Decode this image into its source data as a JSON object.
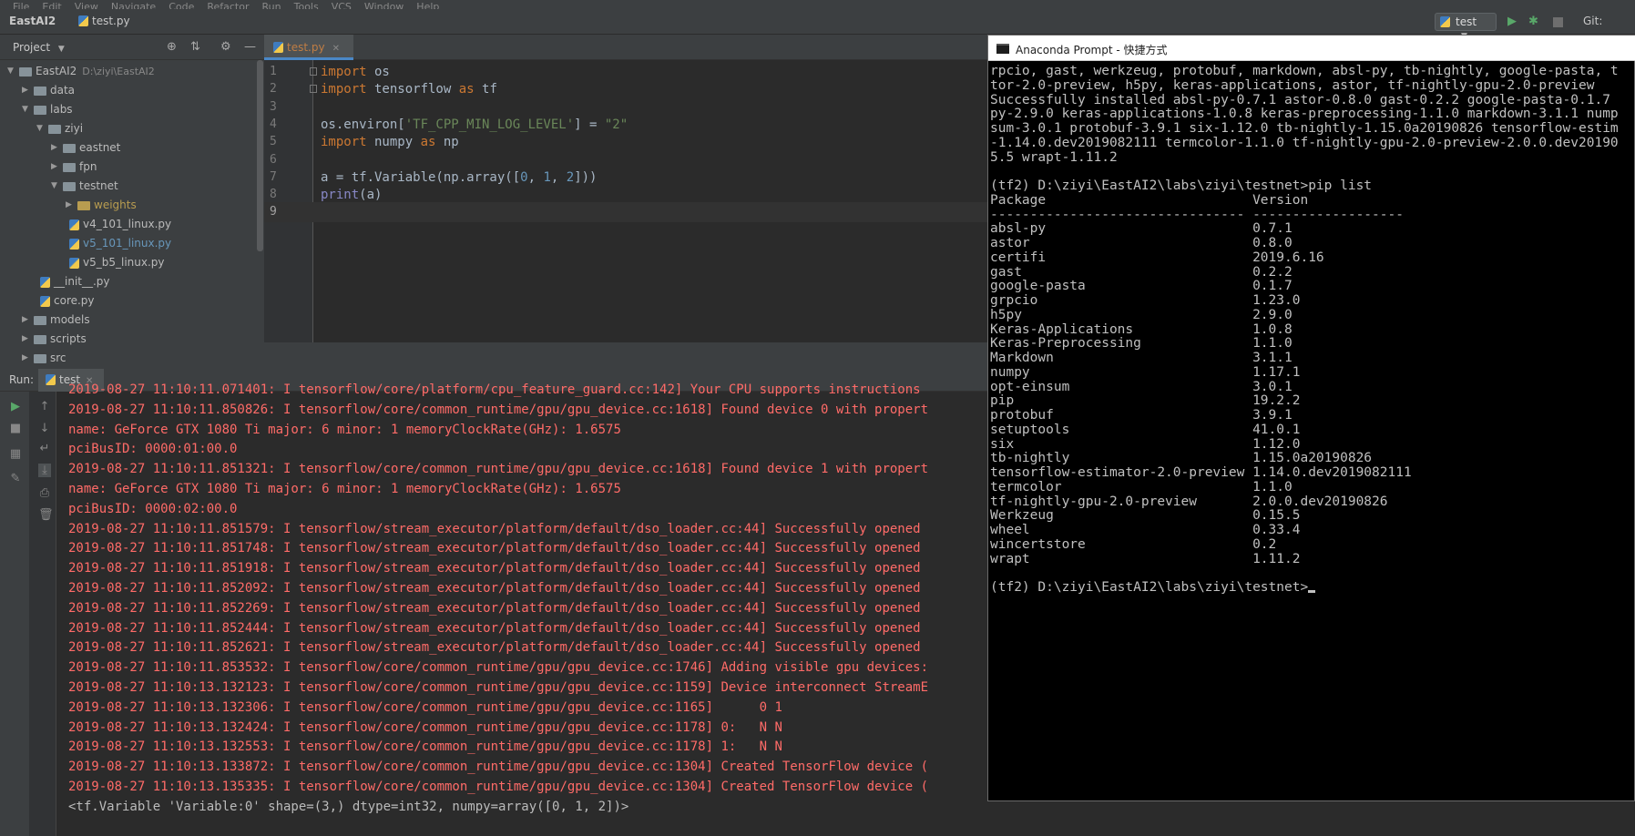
{
  "menubar": [
    "File",
    "Edit",
    "View",
    "Navigate",
    "Code",
    "Refactor",
    "Run",
    "Tools",
    "VCS",
    "Window",
    "Help"
  ],
  "navbar": {
    "project": "EastAI2",
    "file": "test.py",
    "run_config": "test",
    "git_label": "Git:"
  },
  "project_panel": {
    "title": "Project",
    "tree": [
      {
        "label": "EastAI2",
        "hint": "D:\\ziyi\\EastAI2",
        "depth": 0,
        "kind": "folder",
        "open": true
      },
      {
        "label": "data",
        "depth": 1,
        "kind": "folder",
        "open": false
      },
      {
        "label": "labs",
        "depth": 1,
        "kind": "folder",
        "open": true
      },
      {
        "label": "ziyi",
        "depth": 2,
        "kind": "folder",
        "open": true
      },
      {
        "label": "eastnet",
        "depth": 3,
        "kind": "folder",
        "open": false
      },
      {
        "label": "fpn",
        "depth": 3,
        "kind": "folder",
        "open": false
      },
      {
        "label": "testnet",
        "depth": 3,
        "kind": "folder",
        "open": true
      },
      {
        "label": "weights",
        "depth": 4,
        "kind": "folder-gold",
        "open": false
      },
      {
        "label": "v4_101_linux.py",
        "depth": 4,
        "kind": "file"
      },
      {
        "label": "v5_101_linux.py",
        "depth": 4,
        "kind": "file",
        "selected": true
      },
      {
        "label": "v5_b5_linux.py",
        "depth": 4,
        "kind": "file"
      },
      {
        "label": "__init__.py",
        "depth": 2,
        "kind": "file"
      },
      {
        "label": "core.py",
        "depth": 2,
        "kind": "file"
      },
      {
        "label": "models",
        "depth": 1,
        "kind": "folder",
        "open": false
      },
      {
        "label": "scripts",
        "depth": 1,
        "kind": "folder",
        "open": false
      },
      {
        "label": "src",
        "depth": 1,
        "kind": "folder",
        "open": false
      }
    ]
  },
  "editor": {
    "tab": "test.py",
    "lines": [
      {
        "n": "1",
        "tokens": [
          [
            "kw",
            "import"
          ],
          [
            "",
            " os"
          ]
        ]
      },
      {
        "n": "2",
        "tokens": [
          [
            "kw",
            "import"
          ],
          [
            "",
            " tensorflow "
          ],
          [
            "kw",
            "as"
          ],
          [
            "",
            " tf"
          ]
        ]
      },
      {
        "n": "3",
        "tokens": []
      },
      {
        "n": "4",
        "tokens": [
          [
            "",
            "os.environ["
          ],
          [
            "str",
            "'TF_CPP_MIN_LOG_LEVEL'"
          ],
          [
            "",
            "] = "
          ],
          [
            "str",
            "\"2\""
          ]
        ]
      },
      {
        "n": "5",
        "tokens": [
          [
            "kw",
            "import"
          ],
          [
            "",
            " numpy "
          ],
          [
            "kw",
            "as"
          ],
          [
            "",
            " np"
          ]
        ]
      },
      {
        "n": "6",
        "tokens": []
      },
      {
        "n": "7",
        "tokens": [
          [
            "",
            "a = tf.Variable(np.array(["
          ],
          [
            "num",
            "0"
          ],
          [
            "",
            ", "
          ],
          [
            "num",
            "1"
          ],
          [
            "",
            ", "
          ],
          [
            "num",
            "2"
          ],
          [
            "",
            "]))"
          ]
        ]
      },
      {
        "n": "8",
        "tokens": [
          [
            "fn",
            "print"
          ],
          [
            "",
            "(a)"
          ]
        ]
      },
      {
        "n": "9",
        "tokens": [],
        "current": true
      }
    ]
  },
  "run_panel": {
    "label": "Run:",
    "tab": "test",
    "console": [
      {
        "t": "2019-08-27 11:10:11.071401: I tensorflow/core/platform/cpu_feature_guard.cc:142] Your CPU supports instructions",
        "out": false
      },
      {
        "t": "2019-08-27 11:10:11.850826: I tensorflow/core/common_runtime/gpu/gpu_device.cc:1618] Found device 0 with propert",
        "out": false
      },
      {
        "t": "name: GeForce GTX 1080 Ti major: 6 minor: 1 memoryClockRate(GHz): 1.6575",
        "out": false
      },
      {
        "t": "pciBusID: 0000:01:00.0",
        "out": false
      },
      {
        "t": "2019-08-27 11:10:11.851321: I tensorflow/core/common_runtime/gpu/gpu_device.cc:1618] Found device 1 with propert",
        "out": false
      },
      {
        "t": "name: GeForce GTX 1080 Ti major: 6 minor: 1 memoryClockRate(GHz): 1.6575",
        "out": false
      },
      {
        "t": "pciBusID: 0000:02:00.0",
        "out": false
      },
      {
        "t": "2019-08-27 11:10:11.851579: I tensorflow/stream_executor/platform/default/dso_loader.cc:44] Successfully opened",
        "out": false
      },
      {
        "t": "2019-08-27 11:10:11.851748: I tensorflow/stream_executor/platform/default/dso_loader.cc:44] Successfully opened",
        "out": false
      },
      {
        "t": "2019-08-27 11:10:11.851918: I tensorflow/stream_executor/platform/default/dso_loader.cc:44] Successfully opened",
        "out": false
      },
      {
        "t": "2019-08-27 11:10:11.852092: I tensorflow/stream_executor/platform/default/dso_loader.cc:44] Successfully opened",
        "out": false
      },
      {
        "t": "2019-08-27 11:10:11.852269: I tensorflow/stream_executor/platform/default/dso_loader.cc:44] Successfully opened",
        "out": false
      },
      {
        "t": "2019-08-27 11:10:11.852444: I tensorflow/stream_executor/platform/default/dso_loader.cc:44] Successfully opened",
        "out": false
      },
      {
        "t": "2019-08-27 11:10:11.852621: I tensorflow/stream_executor/platform/default/dso_loader.cc:44] Successfully opened",
        "out": false
      },
      {
        "t": "2019-08-27 11:10:11.853532: I tensorflow/core/common_runtime/gpu/gpu_device.cc:1746] Adding visible gpu devices:",
        "out": false
      },
      {
        "t": "2019-08-27 11:10:13.132123: I tensorflow/core/common_runtime/gpu/gpu_device.cc:1159] Device interconnect StreamE",
        "out": false
      },
      {
        "t": "2019-08-27 11:10:13.132306: I tensorflow/core/common_runtime/gpu/gpu_device.cc:1165]      0 1",
        "out": false
      },
      {
        "t": "2019-08-27 11:10:13.132424: I tensorflow/core/common_runtime/gpu/gpu_device.cc:1178] 0:   N N",
        "out": false
      },
      {
        "t": "2019-08-27 11:10:13.132553: I tensorflow/core/common_runtime/gpu/gpu_device.cc:1178] 1:   N N",
        "out": false
      },
      {
        "t": "2019-08-27 11:10:13.133872: I tensorflow/core/common_runtime/gpu/gpu_device.cc:1304] Created TensorFlow device (",
        "out": false
      },
      {
        "t": "2019-08-27 11:10:13.135335: I tensorflow/core/common_runtime/gpu/gpu_device.cc:1304] Created TensorFlow device (",
        "out": false
      },
      {
        "t": "<tf.Variable 'Variable:0' shape=(3,) dtype=int32, numpy=array([0, 1, 2])>",
        "out": true
      }
    ]
  },
  "conda": {
    "title": "Anaconda Prompt - 快捷方式",
    "lines": [
      "rpcio, gast, werkzeug, protobuf, markdown, absl-py, tb-nightly, google-pasta, t",
      "tor-2.0-preview, h5py, keras-applications, astor, tf-nightly-gpu-2.0-preview",
      "Successfully installed absl-py-0.7.1 astor-0.8.0 gast-0.2.2 google-pasta-0.1.7",
      "py-2.9.0 keras-applications-1.0.8 keras-preprocessing-1.1.0 markdown-3.1.1 nump",
      "sum-3.0.1 protobuf-3.9.1 six-1.12.0 tb-nightly-1.15.0a20190826 tensorflow-estim",
      "-1.14.0.dev2019082111 termcolor-1.1.0 tf-nightly-gpu-2.0-preview-2.0.0.dev20190",
      "5.5 wrapt-1.11.2",
      "",
      "(tf2) D:\\ziyi\\EastAI2\\labs\\ziyi\\testnet>pip list",
      "Package                          Version",
      "-------------------------------- -------------------",
      "absl-py                          0.7.1",
      "astor                            0.8.0",
      "certifi                          2019.6.16",
      "gast                             0.2.2",
      "google-pasta                     0.1.7",
      "grpcio                           1.23.0",
      "h5py                             2.9.0",
      "Keras-Applications               1.0.8",
      "Keras-Preprocessing              1.1.0",
      "Markdown                         3.1.1",
      "numpy                            1.17.1",
      "opt-einsum                       3.0.1",
      "pip                              19.2.2",
      "protobuf                         3.9.1",
      "setuptools                       41.0.1",
      "six                              1.12.0",
      "tb-nightly                       1.15.0a20190826",
      "tensorflow-estimator-2.0-preview 1.14.0.dev2019082111",
      "termcolor                        1.1.0",
      "tf-nightly-gpu-2.0-preview       2.0.0.dev20190826",
      "Werkzeug                         0.15.5",
      "wheel                            0.33.4",
      "wincertstore                     0.2",
      "wrapt                            1.11.2",
      "",
      "(tf2) D:\\ziyi\\EastAI2\\labs\\ziyi\\testnet>"
    ]
  }
}
